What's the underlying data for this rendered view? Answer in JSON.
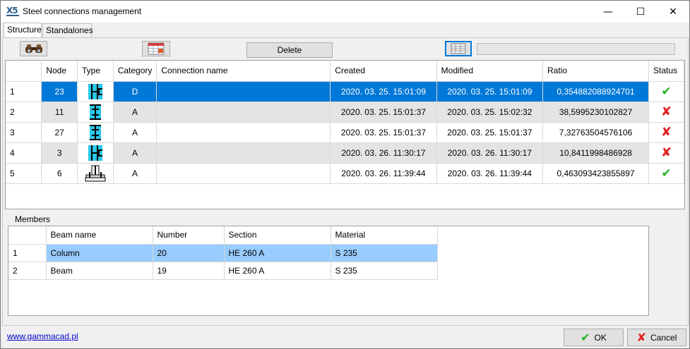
{
  "window": {
    "title": "Steel connections management",
    "icon_text": "X5",
    "controls": {
      "minimize": "—",
      "maximize": "☐",
      "close": "✕"
    }
  },
  "tabs": [
    {
      "label": "Structure",
      "active": true
    },
    {
      "label": "Standalones",
      "active": false
    }
  ],
  "toolbar": {
    "search_icon": "binoculars-icon",
    "table_icon": "table-export-icon",
    "delete_label": "Delete",
    "grid_icon": "grid-icon",
    "progress": 0
  },
  "connections": {
    "columns": [
      "",
      "Node",
      "Type",
      "Category",
      "Connection name",
      "Created",
      "Modified",
      "Ratio",
      "Status"
    ],
    "rows": [
      {
        "index": "1",
        "node": "23",
        "type_icon": "column-beam-connection-icon",
        "category": "D",
        "name": "",
        "created": "2020. 03. 25.  15:01:09",
        "modified": "2020. 03. 25.  15:01:09",
        "ratio": "0,354882088924701",
        "status": "ok",
        "selected": true
      },
      {
        "index": "2",
        "node": "11",
        "type_icon": "column-beam-connection-icon",
        "category": "A",
        "name": "",
        "created": "2020. 03. 25.  15:01:37",
        "modified": "2020. 03. 25.  15:02:32",
        "ratio": "38,5995230102827",
        "status": "fail",
        "selected": false
      },
      {
        "index": "3",
        "node": "27",
        "type_icon": "column-beam-connection-icon",
        "category": "A",
        "name": "",
        "created": "2020. 03. 25.  15:01:37",
        "modified": "2020. 03. 25.  15:01:37",
        "ratio": "7,32763504576106",
        "status": "fail",
        "selected": false
      },
      {
        "index": "4",
        "node": "3",
        "type_icon": "column-beam-connection-icon",
        "category": "A",
        "name": "",
        "created": "2020. 03. 26.  11:30:17",
        "modified": "2020. 03. 26.  11:30:17",
        "ratio": "10,8411998486928",
        "status": "fail",
        "selected": false
      },
      {
        "index": "5",
        "node": "6",
        "type_icon": "base-plate-connection-icon",
        "category": "A",
        "name": "",
        "created": "2020. 03. 26.  11:39:44",
        "modified": "2020. 03. 26.  11:39:44",
        "ratio": "0,463093423855897",
        "status": "ok",
        "selected": false
      }
    ]
  },
  "members": {
    "label": "Members",
    "columns": [
      "",
      "Beam name",
      "Number",
      "Section",
      "Material"
    ],
    "rows": [
      {
        "index": "1",
        "beam_name": "Column",
        "number": "20",
        "section": "HE  260 A",
        "material": "S 235",
        "selected": true
      },
      {
        "index": "2",
        "beam_name": "Beam",
        "number": "19",
        "section": "HE  260 A",
        "material": "S 235",
        "selected": false
      }
    ]
  },
  "footer": {
    "link": "www.gammacad.pl",
    "ok_label": "OK",
    "cancel_label": "Cancel"
  },
  "colors": {
    "selection": "#0078d7",
    "member_selection": "#99ccff",
    "ok_green": "#1fb31f",
    "fail_red": "#e02020"
  }
}
